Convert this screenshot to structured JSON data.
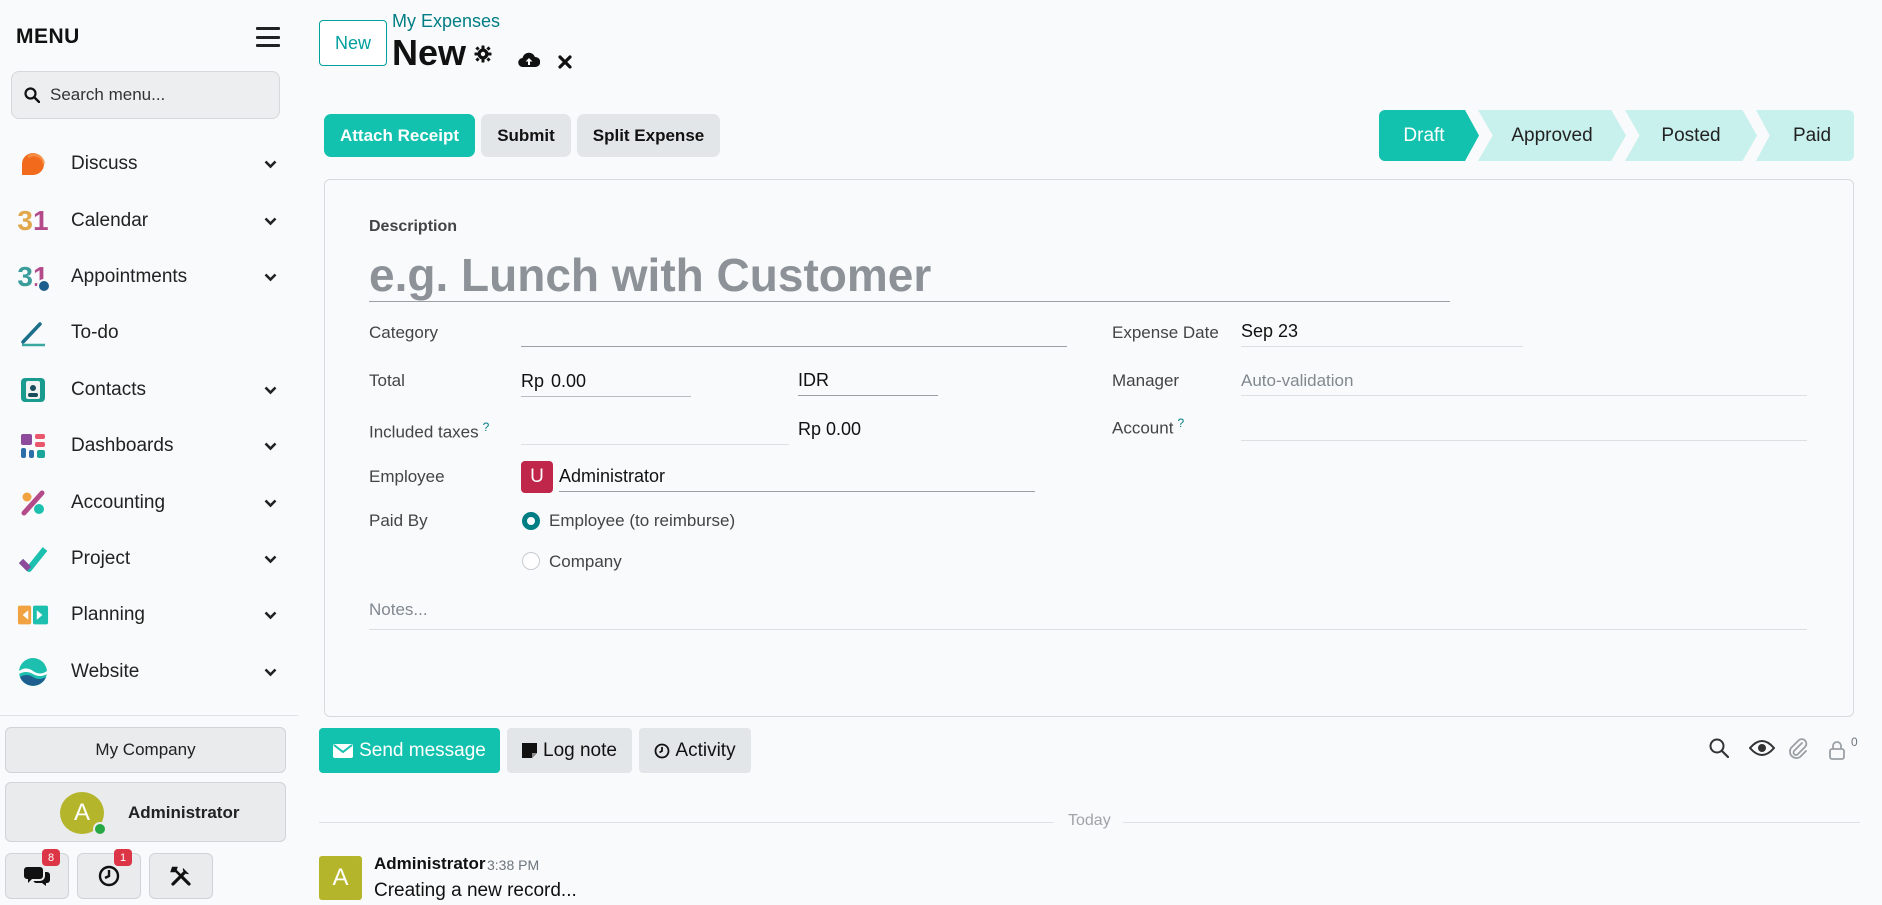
{
  "sidebar": {
    "title": "MENU",
    "search_placeholder": "Search menu...",
    "items": [
      {
        "label": "Discuss",
        "has_children": true
      },
      {
        "label": "Calendar",
        "has_children": true
      },
      {
        "label": "Appointments",
        "has_children": true
      },
      {
        "label": "To-do",
        "has_children": false
      },
      {
        "label": "Contacts",
        "has_children": true
      },
      {
        "label": "Dashboards",
        "has_children": true
      },
      {
        "label": "Accounting",
        "has_children": true
      },
      {
        "label": "Project",
        "has_children": true
      },
      {
        "label": "Planning",
        "has_children": true
      },
      {
        "label": "Website",
        "has_children": true
      }
    ],
    "calendar_icon_text": "31",
    "company": "My Company",
    "user": {
      "initial": "A",
      "name": "Administrator",
      "avatar_color": "#b5b52b"
    },
    "tools": {
      "messages_count": "8",
      "activities_count": "1"
    }
  },
  "header": {
    "new_button": "New",
    "breadcrumb": "My Expenses",
    "record_title": "New"
  },
  "actions": {
    "attach_receipt": "Attach Receipt",
    "submit": "Submit",
    "split_expense": "Split Expense"
  },
  "status": {
    "steps": [
      "Draft",
      "Approved",
      "Posted",
      "Paid"
    ],
    "active": "Draft",
    "active_color": "#13c2ae",
    "inactive_color": "#c8f0ec"
  },
  "form": {
    "description_label": "Description",
    "description_placeholder": "e.g. Lunch with Customer",
    "category_label": "Category",
    "category_value": "",
    "total_label": "Total",
    "total_currency_symbol": "Rp",
    "total_value": "0.00",
    "currency": "IDR",
    "included_taxes_label": "Included taxes",
    "help_mark": "?",
    "included_taxes_value": "Rp 0.00",
    "employee_label": "Employee",
    "employee_initial": "U",
    "employee_value": "Administrator",
    "paid_by_label": "Paid By",
    "paid_by_options": [
      "Employee (to reimburse)",
      "Company"
    ],
    "paid_by_selected": "Employee (to reimburse)",
    "expense_date_label": "Expense Date",
    "expense_date_value": "Sep 23",
    "manager_label": "Manager",
    "manager_placeholder": "Auto-validation",
    "account_label": "Account",
    "account_value": "",
    "notes_placeholder": "Notes..."
  },
  "chatter": {
    "send_message": "Send message",
    "log_note": "Log note",
    "activity": "Activity",
    "follower_count": "0",
    "date_separator": "Today",
    "messages": [
      {
        "author": "Administrator",
        "initial": "A",
        "time": "3:38 PM",
        "body": "Creating a new record..."
      }
    ]
  }
}
